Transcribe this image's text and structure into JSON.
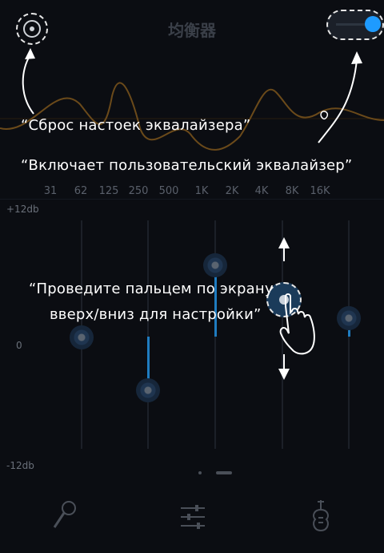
{
  "header": {
    "title": "均衡器"
  },
  "bands": [
    "31",
    "62",
    "125",
    "250",
    "500",
    "1K",
    "2K",
    "4K",
    "8K",
    "16K"
  ],
  "scale": {
    "top": "+12db",
    "mid": "0",
    "bottom": "-12db"
  },
  "tips": {
    "reset": "“Сброс настоек эквалайзера”",
    "enable": "“Включает пользовательский эквалайзер”",
    "swipe_line1": "“Проведите пальцем по экрану",
    "swipe_line2": "вверх/вниз для настройки”"
  },
  "colors": {
    "accent": "#1e9bff",
    "curve": "#6b4a1a",
    "background": "#0b0d12"
  },
  "icons": {
    "reset": "reset-icon",
    "toggle": "toggle-switch",
    "mic": "microphone-icon",
    "sliders": "sliders-icon",
    "guitar": "guitar-icon"
  }
}
